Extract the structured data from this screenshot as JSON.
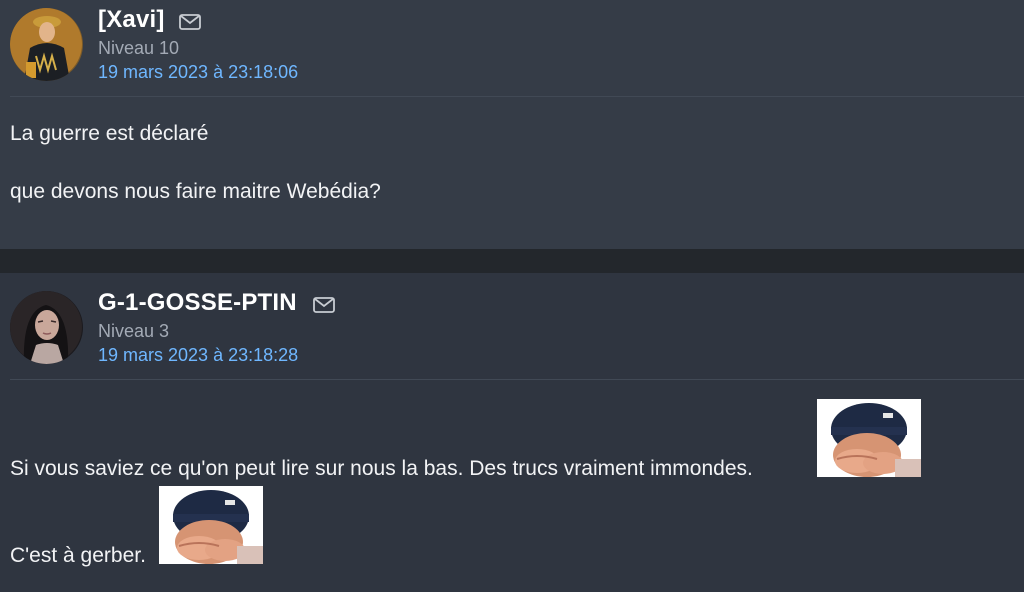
{
  "posts": [
    {
      "author": "[Xavi]",
      "level": "Niveau 10",
      "date": "19 mars 2023 à 23:18:06",
      "avatar": "knight-portrait-avatar",
      "lines": [
        "La guerre est déclaré",
        "que devons nous faire maitre Webédia?"
      ]
    },
    {
      "author": "G-1-GOSSE-PTIN",
      "level": "Niveau 3",
      "date": "19 mars 2023 à 23:18:28",
      "avatar": "dark-haired-woman-avatar",
      "lines": [
        "Si vous saviez ce qu'on peut lire sur nous la bas. Des trucs vraiment immondes.",
        "C'est à gerber."
      ],
      "stickers": [
        "facepalm-beanie-sticker",
        "facepalm-beanie-sticker"
      ]
    }
  ],
  "icons": {
    "mail": "envelope-icon"
  },
  "colors": {
    "username": "#ffffff",
    "date_link": "#6fb7ff",
    "level": "#a3aab5",
    "post_bg": "#353c47"
  }
}
